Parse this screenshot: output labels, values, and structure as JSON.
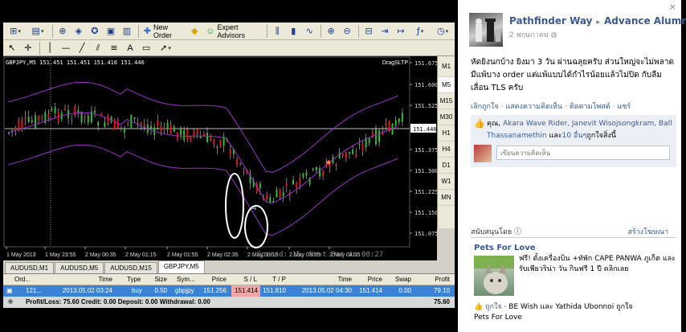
{
  "toolbar": {
    "new_order": "New Order",
    "expert_advisors": "Expert Advisors"
  },
  "chart": {
    "info": "GBPJPY,M5  151.451 151.451 151.416 151.446",
    "drag_label": "DragSLTP",
    "spread_label": "Spread: 15, Next Bar in 00:27",
    "current_price": "151.446",
    "price_labels": [
      "151.675",
      "151.600",
      "151.525",
      "151.446",
      "151.375",
      "151.300",
      "151.225",
      "151.150",
      "151.075"
    ],
    "time_labels": [
      "1 May 2013",
      "1 May 23:55",
      "2 May 00:35",
      "2 May 01:15",
      "2 May 01:55",
      "2 May 02:35",
      "2 May 03:15",
      "2 May 03:55",
      "2 May 04:35"
    ],
    "candle_colors": {
      "bull": "#2dbd2d",
      "bear": "#e01414",
      "band": "#a02bd1",
      "wick": "#cfcfcf"
    }
  },
  "timeframes": [
    "M1",
    "M5",
    "M15",
    "M30",
    "H1",
    "H4",
    "D1",
    "W1",
    "MN"
  ],
  "active_timeframe": "M5",
  "chart_tabs": [
    "AUDUSD,M1",
    "AUDUSD,M5",
    "AUDUSD,M15",
    "GBPJPY,M5"
  ],
  "active_chart_tab": "GBPJPY,M5",
  "terminal": {
    "headers": {
      "order": "Ord...",
      "time": "Time",
      "type": "Type",
      "size": "Size",
      "symbol": "Sym...",
      "price": "Price",
      "sl": "S / L",
      "tp": "T / P",
      "close_time": "Time",
      "close_price": "Price",
      "swap": "Swap",
      "profit": "Profit"
    },
    "row": {
      "order": "121...",
      "time": "2013.05.02 03:24",
      "type": "buy",
      "size": "0.50",
      "symbol": "gbpjpy",
      "price": "151.256",
      "sl": "151.414",
      "tp": "151.810",
      "close_time": "2013.05.02 04:30",
      "close_price": "151.414",
      "swap": "0.00",
      "profit": "79.10"
    },
    "summary": "Profit/Loss: 75.60  Credit: 0.00  Deposit: 0.00  Withdrawal: 0.00",
    "summary_total": "75.60"
  },
  "facebook": {
    "close": "×",
    "author": "Pathfinder Way",
    "group": "Advance Alumni",
    "date": "2 พฤษภาคม",
    "post_text": "หัดยิงนกบ้าง ยิงมา 3 วัน ผ่านฉลุยครับ ส่วนใหญ่จะไม่พลาด มีแพ้บาง order แต่แพ้แบบได้กำไรน้อยแล้วไม่ปิด กับลืมเลื่อน TLS ครับ",
    "actions": [
      "เลิกถูกใจ",
      "แสดงความคิดเห็น",
      "ติดตามโพสต์",
      "แชร์"
    ],
    "likes_you": "คุณ,",
    "likes_names": "Akara Wave Rider, Janevit Wisojsongkram, Ball Thassanamethin",
    "likes_and": "และ",
    "likes_others": "10 อื่นๆ",
    "likes_suffix": "ถูกใจสิ่งนี้",
    "comment_placeholder": "เขียนความคิดเห็น",
    "sponsored": "สนับสนุนโดย ",
    "create_ad": "สร้างโฆษณา",
    "ad_title": "Pets For Love",
    "ad_text": "ฟรี! ตั้งเครื่องบิน +ทัพัก CAPE PANWA ภูเก็ต และรับเพียวริน่า วัน กินฟรี 1 ปี คลิกเลย",
    "ad_like_action": "ถูกใจ",
    "ad_like_names": "BE Wish และ Yathida Ubonnoi ถูกใจ",
    "ad_like_page": "Pets For Love"
  }
}
